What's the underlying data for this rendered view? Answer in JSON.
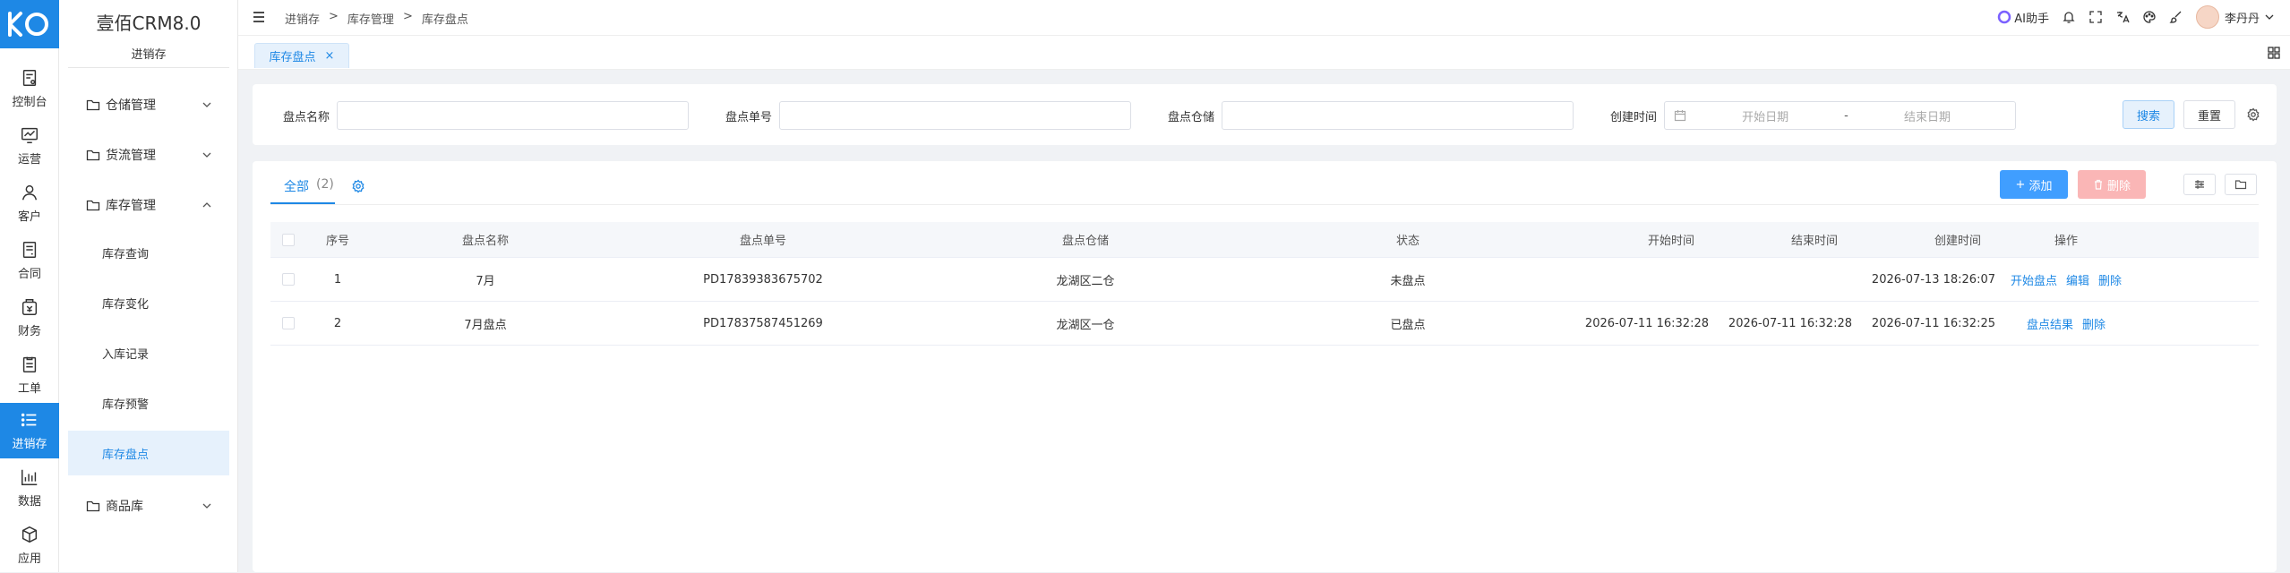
{
  "rail": {
    "items": [
      {
        "label": "控制台",
        "icon": "dashboard-icon"
      },
      {
        "label": "运营",
        "icon": "chart-icon"
      },
      {
        "label": "客户",
        "icon": "user-icon"
      },
      {
        "label": "合同",
        "icon": "contract-icon"
      },
      {
        "label": "财务",
        "icon": "finance-icon"
      },
      {
        "label": "工单",
        "icon": "ticket-icon"
      },
      {
        "label": "进销存",
        "icon": "list-icon"
      },
      {
        "label": "数据",
        "icon": "bar-chart-icon"
      },
      {
        "label": "应用",
        "icon": "box-icon"
      }
    ],
    "active_index": 6,
    "accent": "#1e88e5"
  },
  "sidebar": {
    "title": "壹佰CRM8.0",
    "subtitle": "进销存",
    "groups": [
      {
        "label": "仓储管理",
        "expanded": false
      },
      {
        "label": "货流管理",
        "expanded": false
      },
      {
        "label": "库存管理",
        "expanded": true
      },
      {
        "label": "商品库",
        "expanded": false
      }
    ],
    "leaves": [
      "库存查询",
      "库存变化",
      "入库记录",
      "库存预警",
      "库存盘点"
    ],
    "active_leaf": "库存盘点"
  },
  "header": {
    "breadcrumb": [
      "进销存",
      ">",
      "库存管理",
      ">",
      "库存盘点"
    ],
    "ai_label": "AI助手",
    "user_name": "李丹丹"
  },
  "tabs": [
    {
      "label": "库存盘点",
      "close": "×"
    }
  ],
  "filters": {
    "name_label": "盘点名称",
    "name_value": "",
    "code_label": "盘点单号",
    "code_value": "",
    "warehouse_label": "盘点仓储",
    "warehouse_value": "",
    "created_label": "创建时间",
    "start_placeholder": "开始日期",
    "range_sep": "-",
    "end_placeholder": "结束日期",
    "search_label": "搜索",
    "reset_label": "重置"
  },
  "list": {
    "tab_label": "全部",
    "tab_count": "(2)",
    "add_label": "添加",
    "delete_label": "删除",
    "columns": [
      "序号",
      "盘点名称",
      "盘点单号",
      "盘点仓储",
      "状态",
      "开始时间",
      "结束时间",
      "创建时间",
      "操作"
    ],
    "rows": [
      {
        "no": "1",
        "name": "7月",
        "code": "PD17839383675702",
        "warehouse": "龙湖区二仓",
        "status": "未盘点",
        "start": "",
        "end": "",
        "created": "2026-07-13 18:26:07",
        "actions": [
          "开始盘点",
          "编辑",
          "删除"
        ]
      },
      {
        "no": "2",
        "name": "7月盘点",
        "code": "PD17837587451269",
        "warehouse": "龙湖区一仓",
        "status": "已盘点",
        "start": "2026-07-11 16:32:28",
        "end": "2026-07-11 16:32:28",
        "created": "2026-07-11 16:32:25",
        "actions": [
          "盘点结果",
          "删除"
        ]
      }
    ]
  }
}
